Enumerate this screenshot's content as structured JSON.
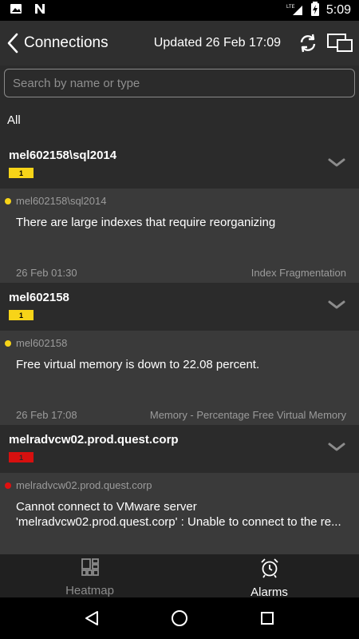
{
  "status_bar": {
    "time": "5:09",
    "network": "LTE",
    "icons": [
      "photo-icon",
      "n-notification-icon",
      "signal-icon",
      "battery-charging-icon"
    ]
  },
  "app_bar": {
    "title": "Connections",
    "updated": "Updated 26 Feb 17:09",
    "icons": [
      "back-arrow-icon",
      "refresh-icon",
      "devices-icon"
    ]
  },
  "search": {
    "placeholder": "Search by name or type",
    "value": ""
  },
  "filter": {
    "label": "All"
  },
  "groups": [
    {
      "name": "mel602158\\sql2014",
      "badge_count": "1",
      "badge_color": "#f7d418",
      "alarm": {
        "severity_color": "#f7d418",
        "source": "mel602158\\sql2014",
        "message_line1": "There are large indexes that require reorganizing",
        "message_line2": "",
        "time": "26 Feb 01:30",
        "type": "Index Fragmentation"
      }
    },
    {
      "name": "mel602158",
      "badge_count": "1",
      "badge_color": "#f7d418",
      "alarm": {
        "severity_color": "#f7d418",
        "source": "mel602158",
        "message_line1": "Free virtual memory is down to 22.08 percent.",
        "message_line2": "",
        "time": "26 Feb 17:08",
        "type": "Memory - Percentage Free Virtual Memory"
      }
    },
    {
      "name": "melradvcw02.prod.quest.corp",
      "badge_count": "1",
      "badge_color": "#d7100f",
      "alarm": {
        "severity_color": "#e01010",
        "source": "melradvcw02.prod.quest.corp",
        "message_line1": "Cannot connect to VMware server",
        "message_line2": "'melradvcw02.prod.quest.corp' : Unable to connect to the re...",
        "time": "",
        "type": ""
      }
    }
  ],
  "tabs": [
    {
      "label": "Heatmap",
      "icon": "heatmap-icon",
      "active": false
    },
    {
      "label": "Alarms",
      "icon": "alarm-clock-icon",
      "active": true
    }
  ],
  "nav_bar": {
    "icons": [
      "back-triangle-icon",
      "home-circle-icon",
      "recents-square-icon"
    ]
  },
  "colors": {
    "background": "#2b2b2b",
    "alarm_card": "#3a3a3a",
    "warning": "#f7d418",
    "critical": "#d7100f"
  }
}
